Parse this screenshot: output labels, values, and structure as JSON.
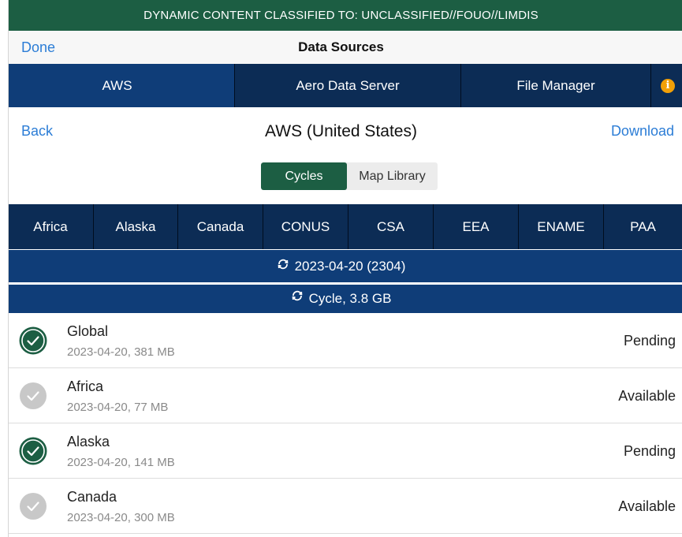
{
  "banner": {
    "text": "DYNAMIC CONTENT CLASSIFIED TO: UNCLASSIFIED//FOUO//LIMDIS",
    "color": "#1c5e43"
  },
  "navbar": {
    "done_label": "Done",
    "title": "Data Sources"
  },
  "tabs": [
    {
      "label": "AWS",
      "active": true
    },
    {
      "label": "Aero Data Server",
      "active": false
    },
    {
      "label": "File Manager",
      "active": false
    }
  ],
  "info_icon": {
    "name": "info-icon",
    "glyph": "i",
    "color": "#f2a007"
  },
  "subnav": {
    "back_label": "Back",
    "title": "AWS (United States)",
    "download_label": "Download"
  },
  "segmented": {
    "options": [
      "Cycles",
      "Map Library"
    ],
    "selected": "Cycles"
  },
  "regions": [
    "Africa",
    "Alaska",
    "Canada",
    "CONUS",
    "CSA",
    "EEA",
    "ENAME",
    "PAA"
  ],
  "cycle": {
    "date_label": "2023-04-20 (2304)",
    "size_label": "Cycle, 3.8 GB",
    "icon": "refresh-icon"
  },
  "items": [
    {
      "title": "Global",
      "subtitle": "2023-04-20, 381 MB",
      "status": "Pending",
      "checked": true
    },
    {
      "title": "Africa",
      "subtitle": "2023-04-20, 77 MB",
      "status": "Available",
      "checked": false
    },
    {
      "title": "Alaska",
      "subtitle": "2023-04-20, 141 MB",
      "status": "Pending",
      "checked": true
    },
    {
      "title": "Canada",
      "subtitle": "2023-04-20, 300 MB",
      "status": "Available",
      "checked": false
    }
  ],
  "colors": {
    "accent_green": "#1c5e43",
    "nav_dark": "#0c2c55",
    "nav_active": "#0f3d78",
    "link_blue": "#2c7dd6",
    "check_inactive": "#c8c8c8"
  }
}
